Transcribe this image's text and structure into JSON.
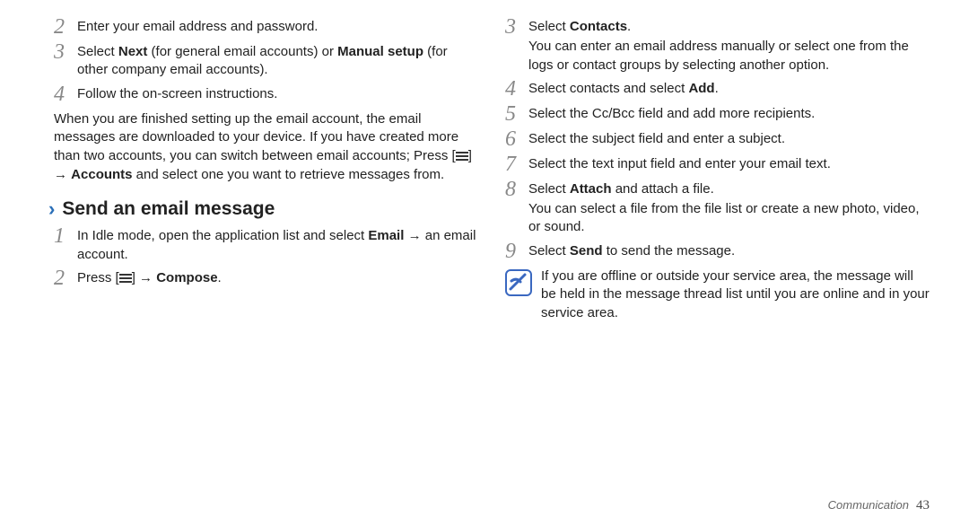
{
  "left": {
    "step2": "Enter your email address and password.",
    "step3_a": "Select ",
    "step3_next": "Next",
    "step3_b": " (for general email accounts) or ",
    "step3_manual": "Manual setup",
    "step3_c": " (for other company email accounts).",
    "step4": "Follow the on-screen instructions.",
    "finished_a": "When you are finished setting up the email account, the email messages are downloaded to your device. If you have created more than two accounts, you can switch between email accounts; Press [",
    "finished_b": "] → ",
    "finished_accounts": "Accounts",
    "finished_c": " and select one you want to retrieve messages from.",
    "heading": "Send an email message",
    "s1_a": "In Idle mode, open the application list and select ",
    "s1_email": "Email",
    "s1_b": " → an email account.",
    "s2_a": "Press [",
    "s2_b": "] → ",
    "s2_compose": "Compose",
    "s2_c": "."
  },
  "right": {
    "r3_a": "Select ",
    "r3_contacts": "Contacts",
    "r3_c": ".",
    "r3_note": "You can enter an email address manually or select one from the logs or contact groups by selecting another option.",
    "r4_a": "Select contacts and select ",
    "r4_add": "Add",
    "r4_c": ".",
    "r5": "Select the Cc/Bcc field and add more recipients.",
    "r6": "Select the subject field and enter a subject.",
    "r7": "Select the text input field and enter your email text.",
    "r8_a": "Select ",
    "r8_attach": "Attach",
    "r8_c": " and attach a file.",
    "r8_note": "You can select a file from the file list or create a new photo, video, or sound.",
    "r9_a": "Select ",
    "r9_send": "Send",
    "r9_c": " to send the message.",
    "infobox": "If you are offline or outside your service area, the message will be held in the message thread list until you are online and in your service area."
  },
  "footer": {
    "section": "Communication",
    "page": "43"
  },
  "nums": {
    "n1": "1",
    "n2": "2",
    "n3": "3",
    "n4": "4",
    "n5": "5",
    "n6": "6",
    "n7": "7",
    "n8": "8",
    "n9": "9"
  }
}
